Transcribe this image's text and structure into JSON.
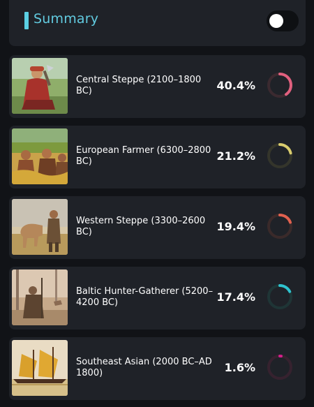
{
  "summary": {
    "title": "Summary",
    "toggle_on": false
  },
  "rows": [
    {
      "label": "Central Steppe (2100–1800 BC)",
      "percent": "40.4%",
      "value": 40.4,
      "color": "#e0607e",
      "track": "#3b2a30",
      "image": "steppe-woman-icon"
    },
    {
      "label": "European Farmer (6300–2800 BC)",
      "percent": "21.2%",
      "value": 21.2,
      "color": "#d9cc6e",
      "track": "#34352b",
      "image": "farmers-icon"
    },
    {
      "label": "Western Steppe (3300–2600 BC)",
      "percent": "19.4%",
      "value": 19.4,
      "color": "#e0614f",
      "track": "#3a2a2a",
      "image": "horseman-icon"
    },
    {
      "label": "Baltic Hunter-Gatherer (5200–4200 BC)",
      "percent": "17.4%",
      "value": 17.4,
      "color": "#2fc3cf",
      "track": "#1f3536",
      "image": "hunter-icon"
    },
    {
      "label": "Southeast Asian (2000 BC–AD 1800)",
      "percent": "1.6%",
      "value": 1.6,
      "color": "#d21f8a",
      "track": "#36222f",
      "image": "sailboat-icon"
    }
  ]
}
